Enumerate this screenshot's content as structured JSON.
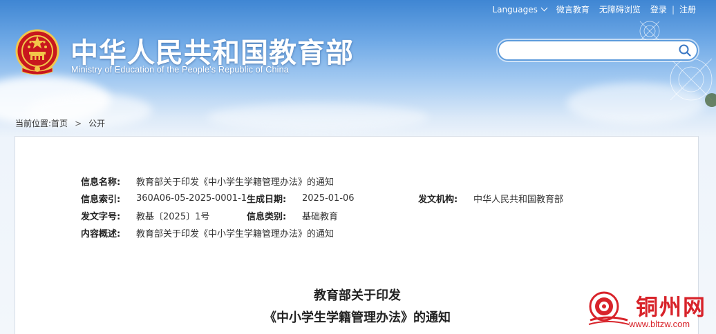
{
  "header": {
    "title": "中华人民共和国教育部",
    "subtitle": "Ministry of Education of the People's Republic of China"
  },
  "topnav": {
    "languages": "Languages",
    "weibo": "微言教育",
    "accessible": "无障碍浏览",
    "login": "登录",
    "register": "注册",
    "separator": "|"
  },
  "search": {
    "placeholder": ""
  },
  "breadcrumb": {
    "prefix": "当前位置:",
    "home": "首页",
    "current": "公开",
    "separator": ">"
  },
  "meta": {
    "info_name_label": "信息名称:",
    "info_name_value": "教育部关于印发《中小学生学籍管理办法》的通知",
    "index_label": "信息索引:",
    "index_value": "360A06-05-2025-0001-1",
    "date_label": "生成日期:",
    "date_value": "2025-01-06",
    "org_label": "发文机构:",
    "org_value": "中华人民共和国教育部",
    "docno_label": "发文字号:",
    "docno_value": "教基〔2025〕1号",
    "category_label": "信息类别:",
    "category_value": "基础教育",
    "summary_label": "内容概述:",
    "summary_value": "教育部关于印发《中小学生学籍管理办法》的通知"
  },
  "document": {
    "title_line1": "教育部关于印发",
    "title_line2": "《中小学生学籍管理办法》的通知"
  },
  "watermark": {
    "text": "铜州网",
    "url": "www.bltzw.com"
  },
  "colors": {
    "sky_top": "#3f86d3",
    "brand_red": "#d8232a",
    "search_border": "#5d9bdc"
  }
}
